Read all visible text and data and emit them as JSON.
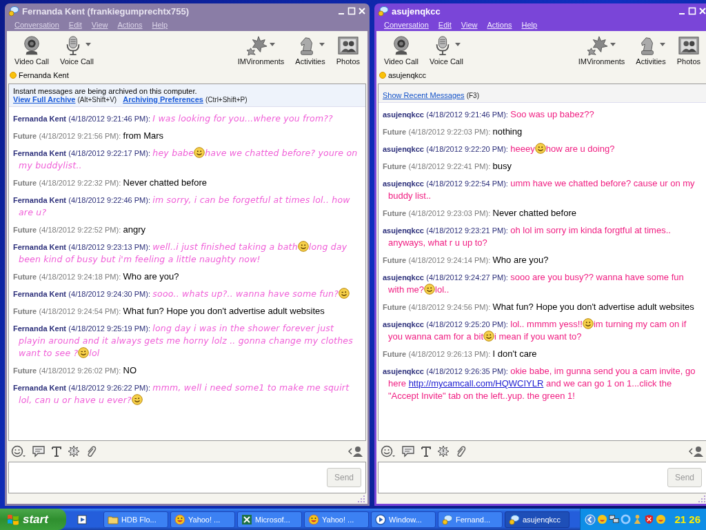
{
  "windows": [
    {
      "title": "Fernanda Kent (frankiegumprechtx755)",
      "active": false,
      "menu": [
        "Conversation",
        "Edit",
        "View",
        "Actions",
        "Help"
      ],
      "toolbar_left": [
        {
          "label": "Video Call",
          "has_menu": false
        },
        {
          "label": "Voice Call",
          "has_menu": true
        }
      ],
      "toolbar_right": [
        {
          "label": "IMVironments",
          "has_menu": true
        },
        {
          "label": "Activities",
          "has_menu": true
        },
        {
          "label": "Photos",
          "has_menu": false
        }
      ],
      "contact": "Fernanda Kent",
      "banner": {
        "kind": "archive",
        "notice": "Instant messages are being archived on this computer.",
        "links": [
          {
            "text": "View Full Archive",
            "shortcut": "(Alt+Shift+V)"
          },
          {
            "text": "Archiving Preferences",
            "shortcut": "(Ctrl+Shift+P)"
          }
        ]
      },
      "messages": [
        {
          "sender": "Fernanda Kent",
          "kind": "remote",
          "time": "(4/18/2012 9:21:46 PM):",
          "parts": [
            {
              "kind": "text",
              "text": "I was looking for you...where you from??"
            }
          ]
        },
        {
          "sender": "Future",
          "kind": "self",
          "time": "(4/18/2012 9:21:56 PM):",
          "parts": [
            {
              "kind": "text",
              "text": "from Mars"
            }
          ]
        },
        {
          "sender": "Fernanda Kent",
          "kind": "remote",
          "time": "(4/18/2012 9:22:17 PM):",
          "parts": [
            {
              "kind": "text",
              "text": "hey babe"
            },
            {
              "kind": "smile"
            },
            {
              "kind": "text",
              "text": "have we chatted before? youre on my buddylist.."
            }
          ]
        },
        {
          "sender": "Future",
          "kind": "self",
          "time": "(4/18/2012 9:22:32 PM):",
          "parts": [
            {
              "kind": "text",
              "text": "Never chatted before"
            }
          ]
        },
        {
          "sender": "Fernanda Kent",
          "kind": "remote",
          "time": "(4/18/2012 9:22:46 PM):",
          "parts": [
            {
              "kind": "text",
              "text": "im sorry, i can be forgetful at times lol.. how are u?"
            }
          ]
        },
        {
          "sender": "Future",
          "kind": "self",
          "time": "(4/18/2012 9:22:52 PM):",
          "parts": [
            {
              "kind": "text",
              "text": "angry"
            }
          ]
        },
        {
          "sender": "Fernanda Kent",
          "kind": "remote",
          "time": "(4/18/2012 9:23:13 PM):",
          "parts": [
            {
              "kind": "text",
              "text": "well..i just finished taking a bath"
            },
            {
              "kind": "smile"
            },
            {
              "kind": "text",
              "text": "long day been kind of busy but i'm feeling a little naughty now!"
            }
          ]
        },
        {
          "sender": "Future",
          "kind": "self",
          "time": "(4/18/2012 9:24:18 PM):",
          "parts": [
            {
              "kind": "text",
              "text": "Who are you?"
            }
          ]
        },
        {
          "sender": "Fernanda Kent",
          "kind": "remote",
          "time": "(4/18/2012 9:24:30 PM):",
          "parts": [
            {
              "kind": "text",
              "text": "sooo.. whats up?.. wanna have some fun?"
            },
            {
              "kind": "wink"
            }
          ]
        },
        {
          "sender": "Future",
          "kind": "self",
          "time": "(4/18/2012 9:24:54 PM):",
          "parts": [
            {
              "kind": "text",
              "text": "What fun? Hope you don't advertise adult websites"
            }
          ]
        },
        {
          "sender": "Fernanda Kent",
          "kind": "remote",
          "time": "(4/18/2012 9:25:19 PM):",
          "parts": [
            {
              "kind": "text",
              "text": "long day i was in the shower forever just playin around and it always gets me horny lolz .. gonna change my clothes want to see ?"
            },
            {
              "kind": "wink"
            },
            {
              "kind": "text",
              "text": "lol"
            }
          ]
        },
        {
          "sender": "Future",
          "kind": "self",
          "time": "(4/18/2012 9:26:02 PM):",
          "parts": [
            {
              "kind": "text",
              "text": "NO"
            }
          ]
        },
        {
          "sender": "Fernanda Kent",
          "kind": "remote",
          "time": "(4/18/2012 9:26:22 PM):",
          "parts": [
            {
              "kind": "text",
              "text": "mmm, well i need some1 to make me squirt lol, can u or have u ever?"
            },
            {
              "kind": "wink"
            }
          ]
        }
      ],
      "send": "Send"
    },
    {
      "title": "asujenqkcc",
      "active": true,
      "menu": [
        "Conversation",
        "Edit",
        "View",
        "Actions",
        "Help"
      ],
      "toolbar_left": [
        {
          "label": "Video Call",
          "has_menu": false
        },
        {
          "label": "Voice Call",
          "has_menu": true
        }
      ],
      "toolbar_right": [
        {
          "label": "IMVironments",
          "has_menu": true
        },
        {
          "label": "Activities",
          "has_menu": true
        },
        {
          "label": "Photos",
          "has_menu": false
        }
      ],
      "contact": "asujenqkcc",
      "banner": {
        "kind": "recent",
        "links": [
          {
            "text": "Show Recent Messages",
            "shortcut": "(F3)"
          }
        ]
      },
      "messages": [
        {
          "sender": "asujenqkcc",
          "kind": "remote",
          "time": "(4/18/2012 9:21:46 PM):",
          "parts": [
            {
              "kind": "text",
              "text": "Soo was up babez??"
            }
          ]
        },
        {
          "sender": "Future",
          "kind": "self",
          "time": "(4/18/2012 9:22:03 PM):",
          "parts": [
            {
              "kind": "text",
              "text": "nothing"
            }
          ]
        },
        {
          "sender": "asujenqkcc",
          "kind": "remote",
          "time": "(4/18/2012 9:22:20 PM):",
          "parts": [
            {
              "kind": "text",
              "text": "heeey"
            },
            {
              "kind": "smile"
            },
            {
              "kind": "text",
              "text": "how are u doing?"
            }
          ]
        },
        {
          "sender": "Future",
          "kind": "self",
          "time": "(4/18/2012 9:22:41 PM):",
          "parts": [
            {
              "kind": "text",
              "text": "busy"
            }
          ]
        },
        {
          "sender": "asujenqkcc",
          "kind": "remote",
          "time": "(4/18/2012 9:22:54 PM):",
          "parts": [
            {
              "kind": "text",
              "text": "umm have we chatted before? cause ur on my buddy list.."
            }
          ]
        },
        {
          "sender": "Future",
          "kind": "self",
          "time": "(4/18/2012 9:23:03 PM):",
          "parts": [
            {
              "kind": "text",
              "text": "Never chatted before"
            }
          ]
        },
        {
          "sender": "asujenqkcc",
          "kind": "remote",
          "time": "(4/18/2012 9:23:21 PM):",
          "parts": [
            {
              "kind": "text",
              "text": "oh lol im sorry im kinda forgtful at times.. anyways, what r u up to?"
            }
          ]
        },
        {
          "sender": "Future",
          "kind": "self",
          "time": "(4/18/2012 9:24:14 PM):",
          "parts": [
            {
              "kind": "text",
              "text": "Who are you?"
            }
          ]
        },
        {
          "sender": "asujenqkcc",
          "kind": "remote",
          "time": "(4/18/2012 9:24:27 PM):",
          "parts": [
            {
              "kind": "text",
              "text": "sooo are you busy?? wanna have some fun with me?"
            },
            {
              "kind": "wink"
            },
            {
              "kind": "text",
              "text": "lol.."
            }
          ]
        },
        {
          "sender": "Future",
          "kind": "self",
          "time": "(4/18/2012 9:24:56 PM):",
          "parts": [
            {
              "kind": "text",
              "text": "What fun? Hope you don't advertise adult websites"
            }
          ]
        },
        {
          "sender": "asujenqkcc",
          "kind": "remote",
          "time": "(4/18/2012 9:25:20 PM):",
          "parts": [
            {
              "kind": "text",
              "text": "lol.. mmmm yess!!"
            },
            {
              "kind": "smile"
            },
            {
              "kind": "text",
              "text": "im turning my cam on if you wanna cam for a bit"
            },
            {
              "kind": "wink"
            },
            {
              "kind": "text",
              "text": "i mean if you want to?"
            }
          ]
        },
        {
          "sender": "Future",
          "kind": "self",
          "time": "(4/18/2012 9:26:13 PM):",
          "parts": [
            {
              "kind": "text",
              "text": "I don't care"
            }
          ]
        },
        {
          "sender": "asujenqkcc",
          "kind": "remote",
          "time": "(4/18/2012 9:26:35 PM):",
          "parts": [
            {
              "kind": "text",
              "text": "okie babe, im gunna send you a cam invite, go here "
            },
            {
              "kind": "link",
              "text": "http://mycamcall.com/HQWCIYLR"
            },
            {
              "kind": "text",
              "text": " and we can go 1 on 1...click the \"Accept Invite\" tab on the left..yup. the green 1!"
            }
          ]
        }
      ],
      "send": "Send"
    }
  ],
  "taskbar": {
    "start": "start",
    "tasks": [
      {
        "kind": "folder",
        "label": "HDB Flo...",
        "selected": false
      },
      {
        "kind": "yahoo",
        "label": "Yahoo! ...",
        "selected": false
      },
      {
        "kind": "sheet",
        "label": "Microsof...",
        "selected": false
      },
      {
        "kind": "yahoo",
        "label": "Yahoo! ...",
        "selected": false
      },
      {
        "kind": "media",
        "label": "Window...",
        "selected": false
      },
      {
        "kind": "messenger",
        "label": "Fernand...",
        "selected": false
      },
      {
        "kind": "messenger",
        "label": "asujenqkcc",
        "selected": true
      }
    ],
    "clock": "21 26"
  }
}
